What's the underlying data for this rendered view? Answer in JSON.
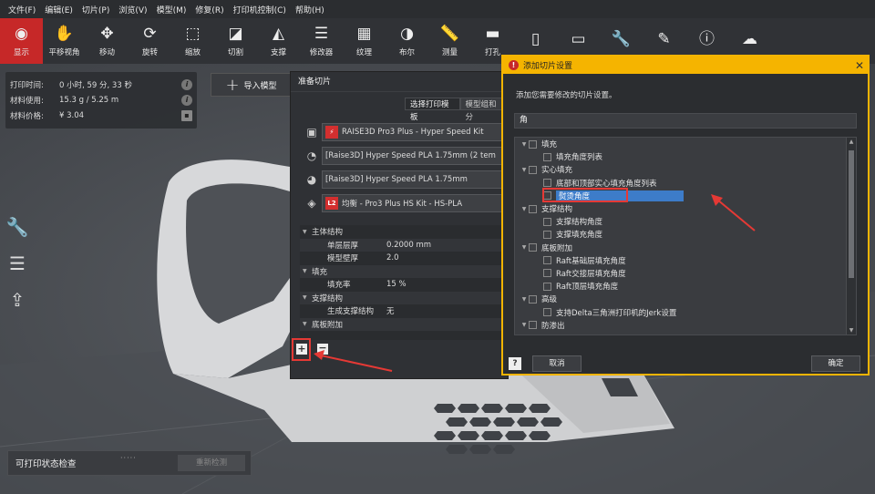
{
  "menubar": [
    "文件(F)",
    "编辑(E)",
    "切片(P)",
    "浏览(V)",
    "模型(M)",
    "修复(R)",
    "打印机控制(C)",
    "帮助(H)"
  ],
  "toolbar": [
    {
      "label": "显示",
      "icon": "eye-icon",
      "glyph": "◉"
    },
    {
      "label": "平移视角",
      "icon": "hand-icon",
      "glyph": "✋"
    },
    {
      "label": "移动",
      "icon": "move-icon",
      "glyph": "✥"
    },
    {
      "label": "旋转",
      "icon": "rotate-icon",
      "glyph": "⟳"
    },
    {
      "label": "缩放",
      "icon": "scale-icon",
      "glyph": "⬚"
    },
    {
      "label": "切割",
      "icon": "cut-icon",
      "glyph": "◪"
    },
    {
      "label": "支撑",
      "icon": "support-icon",
      "glyph": "◭"
    },
    {
      "label": "修改器",
      "icon": "modifier-icon",
      "glyph": "☰"
    },
    {
      "label": "纹理",
      "icon": "texture-icon",
      "glyph": "▦"
    },
    {
      "label": "布尔",
      "icon": "boolean-icon",
      "glyph": "◑"
    },
    {
      "label": "测量",
      "icon": "ruler-icon",
      "glyph": "📏"
    },
    {
      "label": "打孔",
      "icon": "hole-icon",
      "glyph": "▬"
    },
    {
      "label": "",
      "icon": "tool-13-icon",
      "glyph": "▯"
    },
    {
      "label": "",
      "icon": "tool-14-icon",
      "glyph": "▭"
    },
    {
      "label": "",
      "icon": "tool-15-icon",
      "glyph": "🔧"
    },
    {
      "label": "",
      "icon": "tool-16-icon",
      "glyph": "✎"
    },
    {
      "label": "",
      "icon": "info-icon",
      "glyph": "ⓘ"
    },
    {
      "label": "",
      "icon": "cloud-icon",
      "glyph": "☁"
    }
  ],
  "print_info": [
    {
      "label": "打印时间:",
      "value": "0 小时, 59 分, 33 秒"
    },
    {
      "label": "材料使用:",
      "value": "15.3 g / 5.25 m"
    },
    {
      "label": "材料价格:",
      "value": "¥ 3.04"
    }
  ],
  "import_button": "导入模型",
  "slice_panel": {
    "title": "准备切片",
    "tabs": [
      "选择打印模板",
      "模型组和分"
    ],
    "printer": "RAISE3D Pro3 Plus - Hyper Speed Kit",
    "filament_left": "[Raise3D] Hyper Speed PLA 1.75mm (2 tem",
    "filament_right": "[Raise3D] Hyper Speed PLA 1.75mm",
    "profile_badge": "L2",
    "profile": "均衡 - Pro3 Plus HS Kit - HS-PLA",
    "settings": [
      {
        "type": "group",
        "label": "主体结构"
      },
      {
        "type": "item",
        "label": "单层层厚",
        "value": "0.2000 mm"
      },
      {
        "type": "item",
        "label": "模型壁厚",
        "value": "2.0"
      },
      {
        "type": "group",
        "label": "填充"
      },
      {
        "type": "item",
        "label": "填充率",
        "value": "15 %"
      },
      {
        "type": "group",
        "label": "支撑结构"
      },
      {
        "type": "item",
        "label": "生成支撑结构",
        "value": "无"
      },
      {
        "type": "group",
        "label": "底板附加"
      }
    ],
    "add_label": "+",
    "remove_label": "−"
  },
  "dialog": {
    "title": "添加切片设置",
    "hint": "添加您需要修改的切片设置。",
    "search_value": "角",
    "tree": [
      {
        "level": 0,
        "label": "填充"
      },
      {
        "level": 1,
        "label": "填充角度列表"
      },
      {
        "level": 0,
        "label": "实心填充"
      },
      {
        "level": 1,
        "label": "底部和顶部实心填充角度列表"
      },
      {
        "level": 1,
        "label": "熨烫角度",
        "highlight": true
      },
      {
        "level": 0,
        "label": "支撑结构"
      },
      {
        "level": 1,
        "label": "支撑结构角度"
      },
      {
        "level": 1,
        "label": "支撑填充角度"
      },
      {
        "level": 0,
        "label": "底板附加"
      },
      {
        "level": 1,
        "label": "Raft基础层填充角度"
      },
      {
        "level": 1,
        "label": "Raft交接层填充角度"
      },
      {
        "level": 1,
        "label": "Raft顶层填充角度"
      },
      {
        "level": 0,
        "label": "高级"
      },
      {
        "level": 1,
        "label": "支持Delta三角洲打印机的Jerk设置"
      },
      {
        "level": 0,
        "label": "防渗出"
      }
    ],
    "help": "?",
    "cancel": "取消",
    "ok": "确定",
    "close": "✕"
  },
  "status_check": {
    "title": "可打印状态检查",
    "button": "重新检测"
  },
  "colors": {
    "accent": "#c62828",
    "dialog_border": "#f5b400",
    "highlight": "#3d7cc9",
    "annotation": "#e53935"
  }
}
